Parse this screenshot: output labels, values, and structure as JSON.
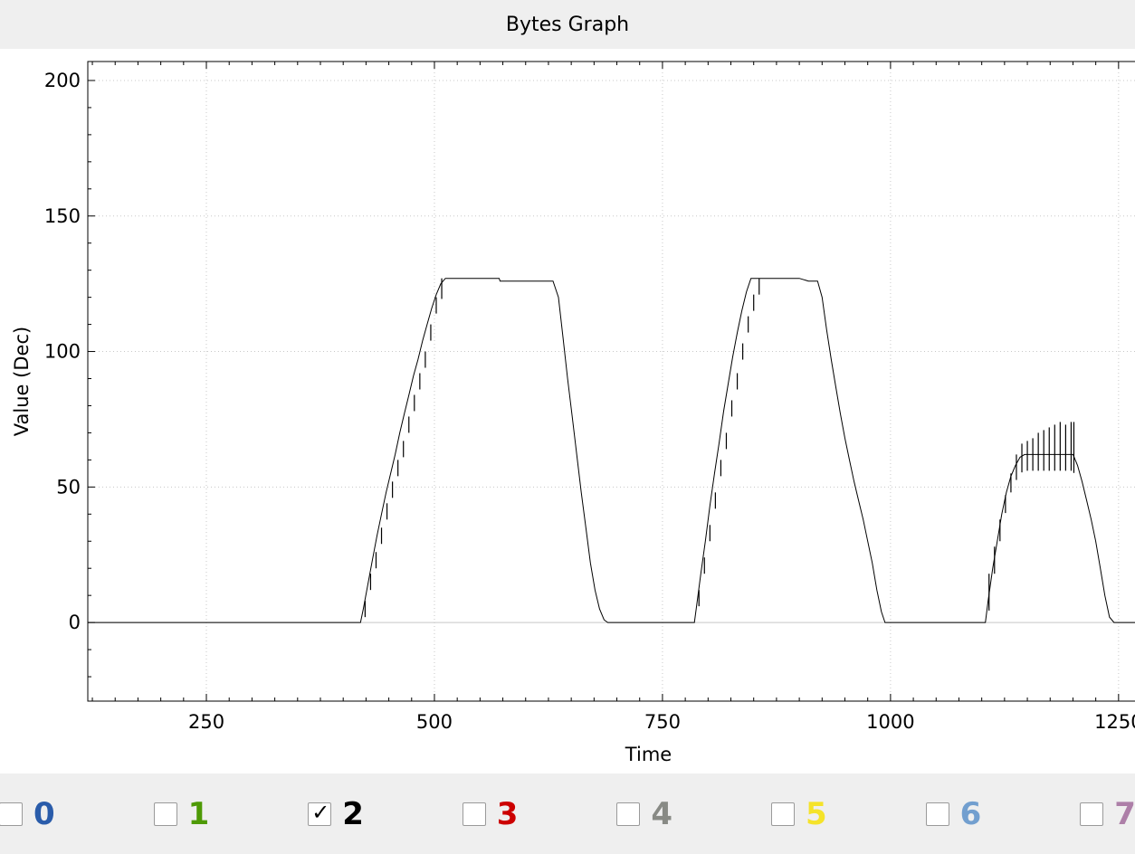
{
  "window": {
    "title": "Bytes Graph"
  },
  "chart_data": {
    "type": "line",
    "title": "",
    "xlabel": "Time",
    "ylabel": "Value (Dec)",
    "xlim": [
      120,
      1270
    ],
    "ylim": [
      -29,
      207
    ],
    "x_ticks": [
      250,
      500,
      750,
      1000,
      1250
    ],
    "y_ticks": [
      0,
      50,
      100,
      150,
      200
    ],
    "grid": true,
    "series": [
      {
        "color": "#000000",
        "x": [
          120,
          419,
          422,
          427,
          432,
          437,
          442,
          447,
          452,
          457,
          462,
          467,
          472,
          477,
          482,
          487,
          492,
          497,
          502,
          507,
          512,
          520,
          535,
          549,
          571,
          572,
          585,
          600,
          615,
          630,
          636,
          641,
          646,
          651,
          656,
          661,
          666,
          671,
          676,
          681,
          686,
          690,
          694,
          697,
          720,
          750,
          785,
          787,
          792,
          797,
          802,
          807,
          812,
          817,
          822,
          827,
          832,
          837,
          842,
          847,
          852,
          857,
          862,
          867,
          872,
          885,
          900,
          910,
          915,
          920,
          925,
          930,
          935,
          940,
          945,
          950,
          955,
          960,
          965,
          970,
          975,
          980,
          985,
          990,
          994,
          1000,
          1050,
          1104,
          1107,
          1112,
          1117,
          1122,
          1127,
          1132,
          1137,
          1142,
          1147,
          1152,
          1157,
          1162,
          1167,
          1172,
          1177,
          1182,
          1188,
          1194,
          1200,
          1205,
          1210,
          1215,
          1220,
          1225,
          1230,
          1235,
          1240,
          1245,
          1250,
          1255,
          1260,
          1265,
          1270
        ],
        "y": [
          0,
          0,
          5,
          14,
          23,
          32,
          40,
          48,
          55,
          62,
          70,
          77,
          84,
          91,
          97,
          104,
          110,
          116,
          121,
          125,
          127,
          127,
          127,
          127,
          127,
          126,
          126,
          126,
          126,
          126,
          120,
          105,
          90,
          76,
          62,
          48,
          35,
          22,
          12,
          5,
          1,
          0,
          0,
          0,
          0,
          0,
          0,
          5,
          18,
          30,
          43,
          55,
          66,
          78,
          88,
          98,
          107,
          115,
          122,
          127,
          127,
          127,
          127,
          127,
          127,
          127,
          127,
          126,
          126,
          126,
          120,
          108,
          97,
          87,
          77,
          68,
          60,
          52,
          45,
          38,
          30,
          22,
          12,
          4,
          0,
          0,
          0,
          0,
          8,
          20,
          30,
          40,
          48,
          54,
          58,
          61,
          62,
          62,
          62,
          62,
          62,
          62,
          62,
          62,
          62,
          62,
          62,
          58,
          52,
          45,
          38,
          30,
          20,
          10,
          2,
          0,
          0,
          0,
          0,
          0,
          0
        ],
        "spike_max": [
          [
            424,
            8
          ],
          [
            430,
            18
          ],
          [
            436,
            26
          ],
          [
            442,
            35
          ],
          [
            448,
            44
          ],
          [
            454,
            52
          ],
          [
            460,
            60
          ],
          [
            466,
            67
          ],
          [
            472,
            76
          ],
          [
            478,
            84
          ],
          [
            484,
            92
          ],
          [
            490,
            100
          ],
          [
            496,
            110
          ],
          [
            502,
            120
          ],
          [
            508,
            127
          ],
          [
            790,
            12
          ],
          [
            796,
            24
          ],
          [
            802,
            36
          ],
          [
            808,
            48
          ],
          [
            814,
            60
          ],
          [
            820,
            70
          ],
          [
            826,
            82
          ],
          [
            832,
            92
          ],
          [
            838,
            103
          ],
          [
            844,
            113
          ],
          [
            850,
            121
          ],
          [
            856,
            127
          ],
          [
            1108,
            18
          ],
          [
            1114,
            28
          ],
          [
            1120,
            38
          ],
          [
            1126,
            47
          ],
          [
            1132,
            55
          ],
          [
            1138,
            62
          ],
          [
            1144,
            66
          ],
          [
            1150,
            67
          ],
          [
            1156,
            68
          ],
          [
            1162,
            70
          ],
          [
            1168,
            71
          ],
          [
            1174,
            72
          ],
          [
            1180,
            73
          ],
          [
            1186,
            74
          ],
          [
            1192,
            73
          ],
          [
            1198,
            74
          ],
          [
            1201,
            74
          ]
        ]
      }
    ]
  },
  "legend": {
    "items": [
      {
        "label": "0",
        "color": "#2a5caa",
        "checked": false
      },
      {
        "label": "1",
        "color": "#4e9a06",
        "checked": false
      },
      {
        "label": "2",
        "color": "#000000",
        "checked": true
      },
      {
        "label": "3",
        "color": "#cc0000",
        "checked": false
      },
      {
        "label": "4",
        "color": "#888a85",
        "checked": false
      },
      {
        "label": "5",
        "color": "#f5e32a",
        "checked": false
      },
      {
        "label": "6",
        "color": "#729fcf",
        "checked": false
      },
      {
        "label": "7",
        "color": "#ad7fa8",
        "checked": false
      }
    ],
    "check_glyph": "✓"
  }
}
